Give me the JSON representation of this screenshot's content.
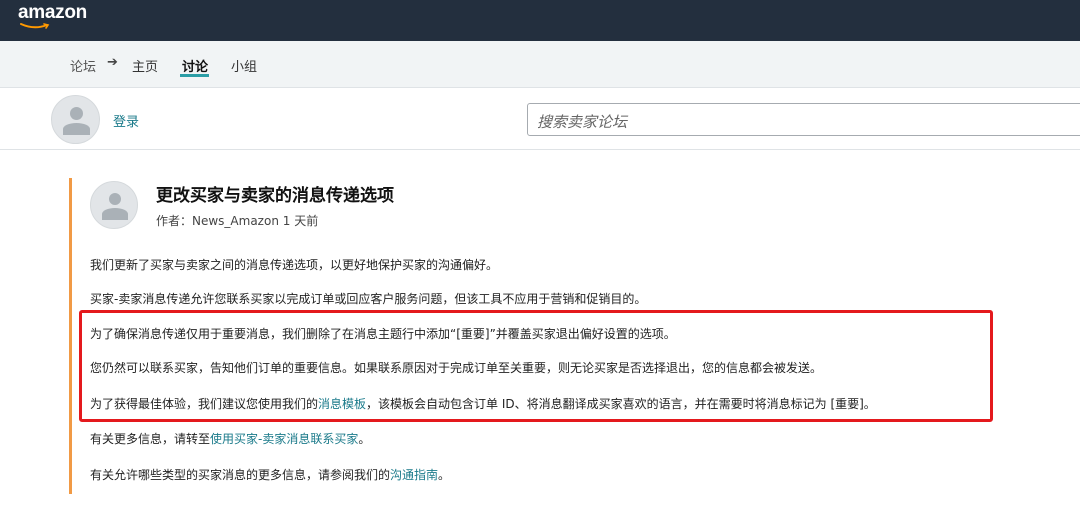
{
  "header": {
    "logo_text": "amazon",
    "brand_color": "#232f3e",
    "smile_color": "#ff9900"
  },
  "nav": {
    "forum": "论坛",
    "arrow": "➔",
    "home": "主页",
    "discussion": "讨论",
    "groups": "小组",
    "active_color": "#2b9ea6"
  },
  "userbar": {
    "login": "登录",
    "search_placeholder": "搜索卖家论坛"
  },
  "post": {
    "title": "更改买家与卖家的消息传递选项",
    "meta": "作者：News_Amazon 1 天前",
    "accent_color": "#f19a45",
    "highlight_color": "#e4191d",
    "paragraphs": {
      "p1": "我们更新了买家与卖家之间的消息传递选项，以更好地保护买家的沟通偏好。",
      "p2": "买家-卖家消息传递允许您联系买家以完成订单或回应客户服务问题，但该工具不应用于营销和促销目的。",
      "p3": "为了确保消息传递仅用于重要消息，我们删除了在消息主题行中添加“[重要]”并覆盖买家退出偏好设置的选项。",
      "p4": "您仍然可以联系买家，告知他们订单的重要信息。如果联系原因对于完成订单至关重要，则无论买家是否选择退出，您的信息都会被发送。",
      "p5_before": "为了获得最佳体验，我们建议您使用我们的",
      "p5_link": "消息模板",
      "p5_after": "，该模板会自动包含订单 ID、将消息翻译成买家喜欢的语言，并在需要时将消息标记为 [重要]。",
      "p6_before": "有关更多信息，请转至",
      "p6_link": "使用买家-卖家消息联系买家",
      "p6_after": "。",
      "p7_before": "有关允许哪些类型的买家消息的更多信息，请参阅我们的",
      "p7_link": "沟通指南",
      "p7_after": "。"
    }
  }
}
